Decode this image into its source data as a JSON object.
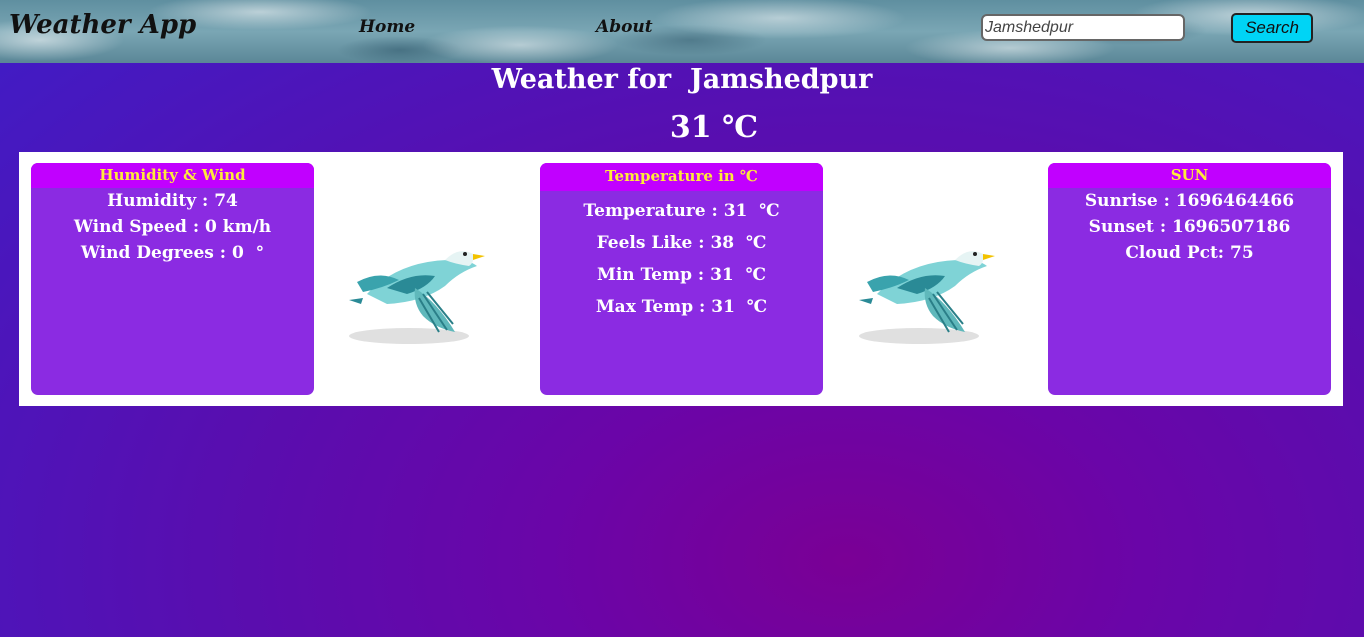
{
  "header": {
    "app_title": "Weather App",
    "nav": [
      {
        "label": "Home"
      },
      {
        "label": "About"
      }
    ],
    "search": {
      "value": "Jamshedpur",
      "placeholder": "Jamshedpur",
      "button_label": "Search"
    }
  },
  "main": {
    "title": "Weather for  Jamshedpur",
    "current_temp": "31 ℃"
  },
  "cards": [
    {
      "header": "Humidity & Wind",
      "rows": [
        "Humidity : 74",
        "Wind Speed : 0 km/h",
        "Wind Degrees : 0  °"
      ]
    },
    {
      "header": "Temperature in ℃",
      "rows": [
        "Temperature : 31  ℃",
        "Feels Like : 38  ℃",
        "Min Temp : 31  ℃",
        "Max Temp : 31  ℃"
      ]
    },
    {
      "header": "SUN",
      "rows": [
        "Sunrise : 1696464466",
        "Sunset : 1696507186",
        "Cloud Pct: 75"
      ]
    }
  ],
  "icons": {
    "bird": "bird-illustration"
  },
  "colors": {
    "card_bg": "#8b2be2",
    "card_header_bg": "#c100ff",
    "card_header_text": "#ffea3a",
    "search_button": "#00d4f5"
  }
}
